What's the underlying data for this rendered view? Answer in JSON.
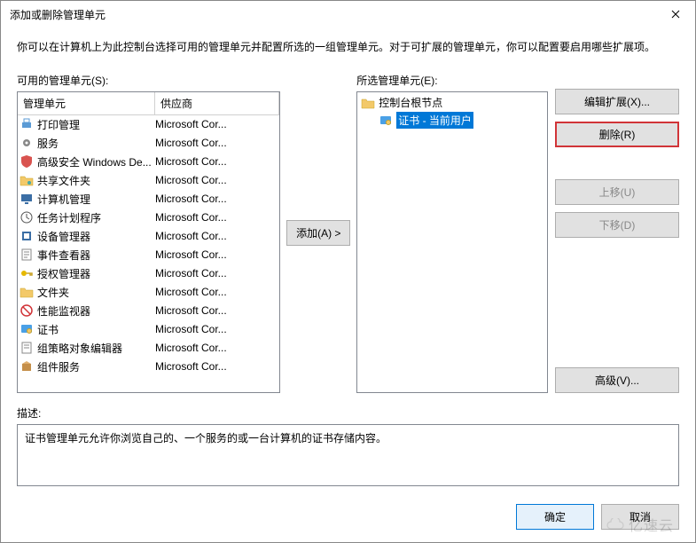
{
  "titlebar": {
    "title": "添加或删除管理单元"
  },
  "intro": "你可以在计算机上为此控制台选择可用的管理单元并配置所选的一组管理单元。对于可扩展的管理单元，你可以配置要启用哪些扩展项。",
  "available": {
    "label": "可用的管理单元(S):",
    "columns": {
      "snapin": "管理单元",
      "vendor": "供应商"
    },
    "items": [
      {
        "name": "打印管理",
        "vendor": "Microsoft Cor...",
        "icon": "printer-icon"
      },
      {
        "name": "服务",
        "vendor": "Microsoft Cor...",
        "icon": "gear-icon"
      },
      {
        "name": "高级安全 Windows De...",
        "vendor": "Microsoft Cor...",
        "icon": "shield-icon"
      },
      {
        "name": "共享文件夹",
        "vendor": "Microsoft Cor...",
        "icon": "folder-share-icon"
      },
      {
        "name": "计算机管理",
        "vendor": "Microsoft Cor...",
        "icon": "pc-icon"
      },
      {
        "name": "任务计划程序",
        "vendor": "Microsoft Cor...",
        "icon": "clock-icon"
      },
      {
        "name": "设备管理器",
        "vendor": "Microsoft Cor...",
        "icon": "device-icon"
      },
      {
        "name": "事件查看器",
        "vendor": "Microsoft Cor...",
        "icon": "event-icon"
      },
      {
        "name": "授权管理器",
        "vendor": "Microsoft Cor...",
        "icon": "key-icon"
      },
      {
        "name": "文件夹",
        "vendor": "Microsoft Cor...",
        "icon": "folder-icon"
      },
      {
        "name": "性能监视器",
        "vendor": "Microsoft Cor...",
        "icon": "block-icon"
      },
      {
        "name": "证书",
        "vendor": "Microsoft Cor...",
        "icon": "cert-icon"
      },
      {
        "name": "组策略对象编辑器",
        "vendor": "Microsoft Cor...",
        "icon": "doc-icon"
      },
      {
        "name": "组件服务",
        "vendor": "Microsoft Cor...",
        "icon": "box-icon"
      }
    ]
  },
  "buttons": {
    "add": "添加(A) >",
    "edit_ext": "编辑扩展(X)...",
    "remove": "删除(R)",
    "move_up": "上移(U)",
    "move_down": "下移(D)",
    "advanced": "高级(V)...",
    "ok": "确定",
    "cancel": "取消"
  },
  "selected": {
    "label": "所选管理单元(E):",
    "root": "控制台根节点",
    "items": [
      {
        "name": "证书 - 当前用户",
        "icon": "cert-icon",
        "selected": true
      }
    ]
  },
  "description": {
    "label": "描述:",
    "text": "证书管理单元允许你浏览自己的、一个服务的或一台计算机的证书存储内容。"
  },
  "watermark": "亿速云"
}
